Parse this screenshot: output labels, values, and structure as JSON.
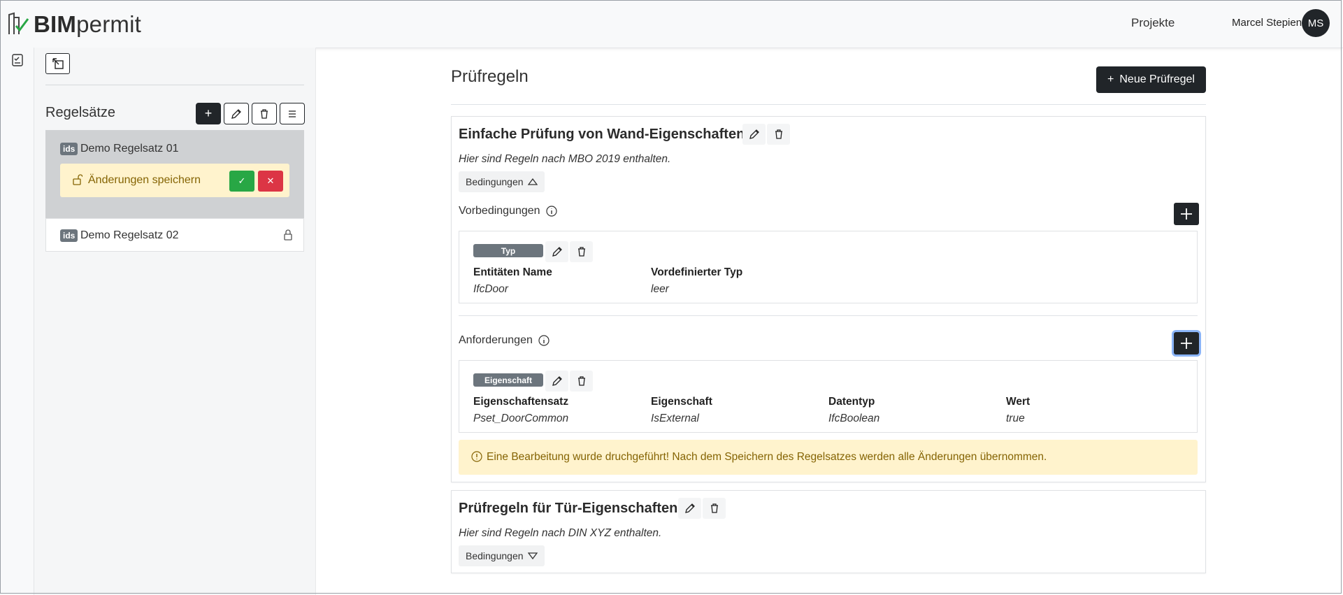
{
  "app": {
    "logo_bold": "BIM",
    "logo_light": "permit"
  },
  "header": {
    "nav_projects": "Projekte",
    "user_name": "Marcel Stepien",
    "avatar_initials": "MS"
  },
  "sidebar": {
    "title": "Regelsätze",
    "add_label": "+",
    "rulesets": [
      {
        "badge": "ids",
        "name": "Demo Regelsatz 01",
        "save_text": "Änderungen speichern",
        "confirm_label": "✓",
        "cancel_label": "✕"
      },
      {
        "badge": "ids",
        "name": "Demo Regelsatz 02"
      }
    ]
  },
  "main": {
    "title": "Prüfregeln",
    "new_rule_label": "Neue Prüfregel",
    "rules": [
      {
        "title": "Einfache Prüfung von Wand-Eigenschaften",
        "description": "Hier sind Regeln nach MBO 2019 enthalten.",
        "conditions_label": "Bedingungen",
        "preconditions": {
          "label": "Vorbedingungen",
          "tag": "Typ",
          "headers": [
            "Entitäten Name",
            "Vordefinierter Typ"
          ],
          "values": [
            "IfcDoor",
            "leer"
          ]
        },
        "requirements": {
          "label": "Anforderungen",
          "tag": "Eigenschaft",
          "headers": [
            "Eigenschaftensatz",
            "Eigenschaft",
            "Datentyp",
            "Wert"
          ],
          "values": [
            "Pset_DoorCommon",
            "IsExternal",
            "IfcBoolean",
            "true"
          ]
        },
        "warning": "Eine Bearbeitung wurde druchgeführt! Nach dem Speichern des Regelsatzes werden alle Änderungen übernommen."
      },
      {
        "title": "Prüfregeln für Tür-Eigenschaften",
        "description": "Hier sind Regeln nach DIN XYZ enthalten.",
        "conditions_label": "Bedingungen"
      }
    ]
  },
  "colors": {
    "dark": "#212529",
    "success": "#28a745",
    "danger": "#dc3545",
    "warning_bg": "#fff3cd",
    "warning_text": "#856404",
    "badge": "#6c757d"
  }
}
